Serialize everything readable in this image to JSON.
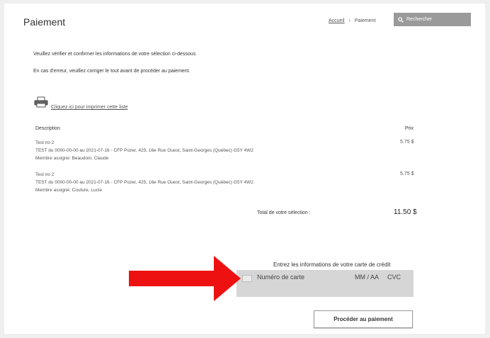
{
  "header": {
    "title": "Paiement",
    "breadcrumb_home": "Accueil",
    "breadcrumb_sep": "›",
    "breadcrumb_current": "Paiement",
    "search_label": "Rechercher"
  },
  "intro": {
    "line1": "Veuillez vérifier et confirmer les informations de votre sélection ci-dessous.",
    "line2": "En cas d'erreur, veuillez corriger le tout avant de procéder au paiement."
  },
  "print_link": "Cliquez ici pour imprimer cette liste",
  "table": {
    "col_description": "Description",
    "col_price": "Prix",
    "rows": [
      {
        "name": "Test no 2",
        "details": "TEST du 0000-00-00 au 2021-07-16 - CFP Pozer, 425, 16e Rue Ouest, Saint-Georges (Québec) G5Y 4W2",
        "member": "Membre assigné: Beaudoin, Claude",
        "price": "5.75 $"
      },
      {
        "name": "Test no 2",
        "details": "TEST du 0000-00-00 au 2021-07-16 - CFP Pozer, 425, 16e Rue Ouest, Saint-Georges (Québec) G5Y 4W2",
        "member": "Membre assigné: Couture, Lucie",
        "price": "5.75 $"
      }
    ],
    "total_label": "Total de votre sélection :",
    "total_value": "11.50 $"
  },
  "card": {
    "label": "Entrez les informations de votre carte de crédit",
    "number_placeholder": "Numéro de carte",
    "date_placeholder": "MM / AA",
    "cvc_placeholder": "CVC"
  },
  "pay_button": "Procéder au paiement",
  "colors": {
    "arrow": "#ee1111",
    "search_bg": "#9a9a9a",
    "card_bg": "#d6d6d6"
  }
}
